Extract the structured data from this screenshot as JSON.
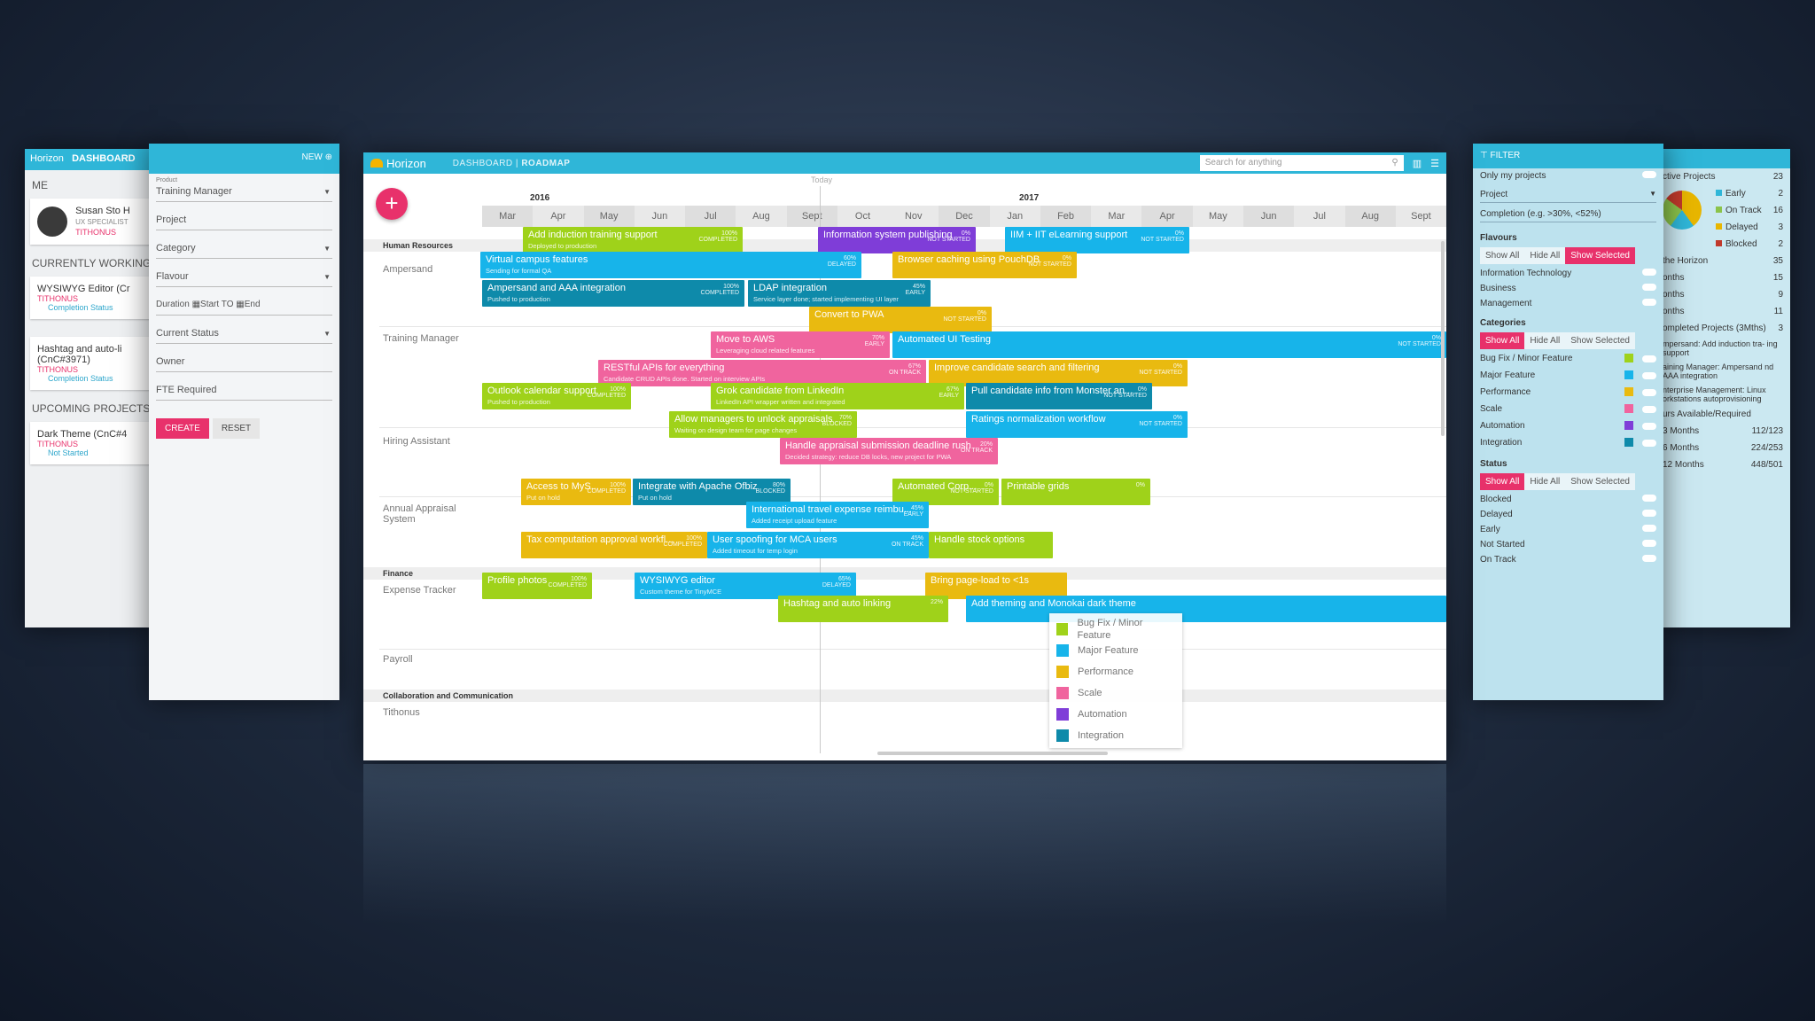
{
  "app": {
    "logo": "Horizon",
    "crumb_dashboard": "DASHBOARD |",
    "crumb_roadmap": "ROADMAP",
    "search_placeholder": "Search for anything",
    "today_label": "Today"
  },
  "timeline": {
    "year_2016": "2016",
    "year_2017": "2017",
    "months": [
      "Mar",
      "Apr",
      "May",
      "Jun",
      "Jul",
      "Aug",
      "Sept",
      "Oct",
      "Nov",
      "Dec",
      "Jan",
      "Feb",
      "Mar",
      "Apr",
      "May",
      "Jun",
      "Jul",
      "Aug",
      "Sept"
    ]
  },
  "groups": {
    "hr": "Human Resources",
    "finance": "Finance",
    "collab": "Collaboration and Communication"
  },
  "rows": {
    "ampersand": "Ampersand",
    "training": "Training Manager",
    "hiring": "Hiring Assistant",
    "appraisal": "Annual Appraisal System",
    "expense": "Expense Tracker",
    "payroll": "Payroll",
    "tithonus": "Tithonus"
  },
  "bars": [
    {
      "title": "Add induction training support",
      "sub": "Deployed to production",
      "status": "100%\nCOMPLETED"
    },
    {
      "title": "Information system publishing",
      "sub": "",
      "status": "0%\nNOT STARTED"
    },
    {
      "title": "IIM + IIT eLearning support",
      "sub": "",
      "status": "0%\nNOT STARTED"
    },
    {
      "title": "Virtual campus features",
      "sub": "Sending for formal QA",
      "status": "60%\nDELAYED"
    },
    {
      "title": "Browser caching using PouchDB",
      "sub": "",
      "status": "0%\nNOT STARTED"
    },
    {
      "title": "Ampersand and AAA integration",
      "sub": "Pushed to production",
      "status": "100%\nCOMPLETED"
    },
    {
      "title": "LDAP integration",
      "sub": "Service layer done; started implementing UI layer",
      "status": "45%\nEARLY"
    },
    {
      "title": "Convert to PWA",
      "sub": "",
      "status": "0%\nNOT STARTED"
    },
    {
      "title": "Move to AWS",
      "sub": "Leveraging cloud related features",
      "status": "70%\nEARLY"
    },
    {
      "title": "Automated UI Testing",
      "sub": "",
      "status": "0%\nNOT STARTED"
    },
    {
      "title": "RESTful APIs for everything",
      "sub": "Candidate CRUD APIs done. Started on interview APIs",
      "status": "67%\nON TRACK"
    },
    {
      "title": "Improve candidate search and filtering",
      "sub": "",
      "status": "0%\nNOT STARTED"
    },
    {
      "title": "Outlook calendar support",
      "sub": "Pushed to production",
      "status": "100%\nCOMPLETED"
    },
    {
      "title": "Grok candidate from LinkedIn",
      "sub": "LinkedIn API wrapper written and integrated",
      "status": "67%\nEARLY"
    },
    {
      "title": "Pull candidate info from Monster an...",
      "sub": "",
      "status": "0%\nNOT STARTED"
    },
    {
      "title": "Allow managers to unlock appraisals",
      "sub": "Waiting on design team for page changes",
      "status": "70%\nBLOCKED"
    },
    {
      "title": "Ratings normalization workflow",
      "sub": "",
      "status": "0%\nNOT STARTED"
    },
    {
      "title": "Handle appraisal submission deadline rush",
      "sub": "Decided strategy: reduce DB locks, new project for PWA",
      "status": "20%\nON TRACK"
    },
    {
      "title": "Access to MyS...",
      "sub": "Put on hold",
      "status": "100%\nCOMPLETED"
    },
    {
      "title": "Integrate with Apache Ofbiz",
      "sub": "Put on hold",
      "status": "80%\nBLOCKED"
    },
    {
      "title": "Automated Corp...",
      "sub": "",
      "status": "0%\nNOT STARTED"
    },
    {
      "title": "Printable grids",
      "sub": "",
      "status": "0%"
    },
    {
      "title": "International travel expense reimbu...",
      "sub": "Added receipt upload feature",
      "status": "45%\nEARLY"
    },
    {
      "title": "Tax computation approval workfl...",
      "sub": "",
      "status": "100%\nCOMPLETED"
    },
    {
      "title": "User spoofing for MCA users",
      "sub": "Added timeout for temp login",
      "status": "45%\nON TRACK"
    },
    {
      "title": "Handle stock options",
      "sub": "",
      "status": ""
    },
    {
      "title": "Profile photos",
      "sub": "",
      "status": "100%\nCOMPLETED"
    },
    {
      "title": "WYSIWYG editor",
      "sub": "Custom theme for TinyMCE",
      "status": "65%\nDELAYED"
    },
    {
      "title": "Bring page-load to <1s",
      "sub": "",
      "status": ""
    },
    {
      "title": "Hashtag and auto linking",
      "sub": "",
      "status": "22%"
    },
    {
      "title": "Add theming and Monokai dark theme",
      "sub": "",
      "status": ""
    }
  ],
  "legend": [
    {
      "label": "Bug Fix / Minor Feature",
      "color": "#9fd21a"
    },
    {
      "label": "Major Feature",
      "color": "#17b4ea"
    },
    {
      "label": "Performance",
      "color": "#e9ba10"
    },
    {
      "label": "Scale",
      "color": "#f0649e"
    },
    {
      "label": "Automation",
      "color": "#7f3dd8"
    },
    {
      "label": "Integration",
      "color": "#0e8aaa"
    }
  ],
  "left_panel": {
    "logo": "Horizon",
    "tab": "DASHBOARD",
    "me": "ME",
    "user_name": "Susan Sto H",
    "user_role": "UX SPECIALIST",
    "user_org": "TITHONUS",
    "currently_working": "CURRENTLY WORKING",
    "card1_title": "WYSIWYG Editor (Cr",
    "card1_org": "TITHONUS",
    "card1_status": "Completion Status",
    "card2_title": "Hashtag and auto-li",
    "card2_title2": "(CnC#3971)",
    "card2_org": "TITHONUS",
    "card2_status": "Completion Status",
    "upcoming": "UPCOMING PROJECTS",
    "card3_title": "Dark Theme (CnC#4",
    "card3_org": "TITHONUS",
    "card3_status": "Not Started"
  },
  "form_panel": {
    "new": "NEW",
    "product_label": "Product",
    "product_value": "Training Manager",
    "project": "Project",
    "category": "Category",
    "flavour": "Flavour",
    "duration": "Duration",
    "start": "Start",
    "to": "TO",
    "end": "End",
    "current_status": "Current Status",
    "owner": "Owner",
    "fte": "FTE Required",
    "create": "CREATE",
    "reset": "RESET"
  },
  "filter_panel": {
    "title": "FILTER",
    "only_my_projects": "Only my projects",
    "project": "Project",
    "completion": "Completion (e.g. >30%, <52%)",
    "flavours": "Flavours",
    "show_all": "Show All",
    "hide_all": "Hide All",
    "show_selected": "Show Selected",
    "flavour_items": [
      "Information Technology",
      "Business",
      "Management"
    ],
    "categories": "Categories",
    "category_items": [
      "Bug Fix / Minor Feature",
      "Major Feature",
      "Performance",
      "Scale",
      "Automation",
      "Integration"
    ],
    "status": "Status",
    "status_items": [
      "Blocked",
      "Delayed",
      "Early",
      "Not Started",
      "On Track"
    ]
  },
  "stats_panel": {
    "active_projects": "ctive Projects",
    "active_count": "23",
    "stats": [
      {
        "label": "Early",
        "value": "2"
      },
      {
        "label": "On Track",
        "value": "16"
      },
      {
        "label": "Delayed",
        "value": "3"
      },
      {
        "label": "Blocked",
        "value": "2"
      }
    ],
    "horizon_rows": [
      {
        "label": "the Horizon",
        "value": "35"
      },
      {
        "label": "onths",
        "value": "15"
      },
      {
        "label": "onths",
        "value": "9"
      },
      {
        "label": "onths",
        "value": "11"
      }
    ],
    "completed": "ompleted Projects (3Mths)",
    "completed_count": "3",
    "completed_items": [
      "mpersand: Add induction tra- ing support",
      "aining Manager: Ampersand nd AAA integration",
      "nterprise Management: Linux orkstations autoprovisioning"
    ],
    "hours": "urs Available/Required",
    "hour_rows": [
      {
        "label": "3 Months",
        "value": "112/123"
      },
      {
        "label": "6 Months",
        "value": "224/253"
      },
      {
        "label": "12 Months",
        "value": "448/501"
      }
    ]
  }
}
